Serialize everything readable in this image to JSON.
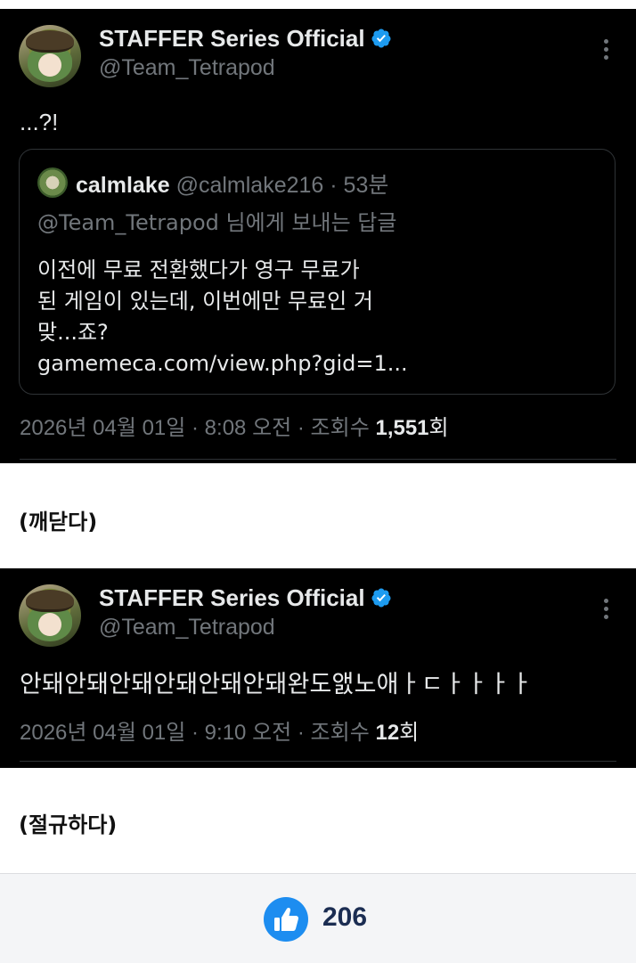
{
  "tweet1": {
    "author_name": "STAFFER Series Official",
    "handle": "@Team_Tetrapod",
    "text": "...?!",
    "quote": {
      "author_name": "calmlake",
      "handle_time": "@calmlake216 · 53분",
      "reply_to": "@Team_Tetrapod 님에게 보내는 답글",
      "lines": [
        "이전에 무료 전환했다가 영구 무료가",
        "된 게임이 있는데, 이번에만 무료인 거",
        "맞...죠?",
        "gamemeca.com/view.php?gid=1..."
      ]
    },
    "timestamp": "2026년 04월 01일 · 8:08 오전 · 조회수 ",
    "views": "1,551",
    "views_unit": "회"
  },
  "caption1": "(깨닫다)",
  "tweet2": {
    "author_name": "STAFFER Series Official",
    "handle": "@Team_Tetrapod",
    "text": "안돼안돼안돼안돼안돼안돼완도앬노애ㅏㄷㅏㅏㅏㅏ",
    "timestamp": "2026년 04월 01일 · 9:10 오전 · 조회수 ",
    "views": "12",
    "views_unit": "회"
  },
  "caption2": "(절규하다)",
  "footer": {
    "like_count": "206"
  },
  "icons": {
    "verified": "verified-badge-icon",
    "more": "more-vertical-icon",
    "like": "thumbs-up-icon"
  },
  "colors": {
    "verified_blue": "#1d9bf0",
    "like_blue": "#1d8df0",
    "tweet_bg": "#000000",
    "muted_text": "#71767b"
  }
}
